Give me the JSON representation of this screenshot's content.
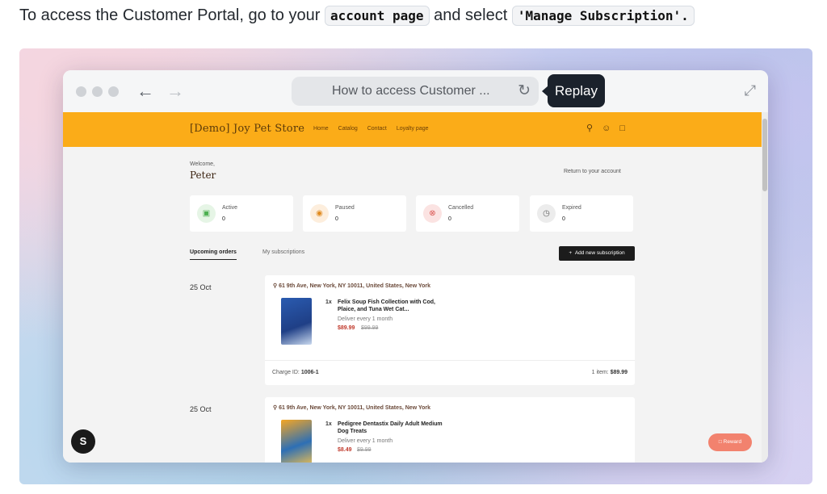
{
  "intro": {
    "text_before": "To access the Customer Portal, go to your ",
    "code1": "account page",
    "text_middle": " and select ",
    "code2": "'Manage Subscription'."
  },
  "browser": {
    "back_icon": "arrow-left-icon",
    "forward_icon": "arrow-right-icon",
    "url_text": "How to access Customer ...",
    "reload_icon": "reload-icon",
    "replay_label": "Replay",
    "expand_icon": "expand-icon"
  },
  "store": {
    "brand": "[Demo] Joy Pet Store",
    "nav": [
      "Home",
      "Catalog",
      "Contact",
      "Loyalty page"
    ],
    "header_icons": [
      "search-icon",
      "account-icon",
      "cart-icon"
    ],
    "accent": "#fbac18"
  },
  "account": {
    "welcome_label": "Welcome,",
    "name": "Peter",
    "return_link": "Return to your account"
  },
  "stats": [
    {
      "label": "Active",
      "count": "0",
      "icon": "box-icon",
      "color": "#4caf50",
      "bg": "#e6f5e6"
    },
    {
      "label": "Paused",
      "count": "0",
      "icon": "pause-icon",
      "color": "#e08a1e",
      "bg": "#fdeedd"
    },
    {
      "label": "Cancelled",
      "count": "0",
      "icon": "cancel-icon",
      "color": "#d9534f",
      "bg": "#fbe3e2"
    },
    {
      "label": "Expired",
      "count": "0",
      "icon": "clock-icon",
      "color": "#666666",
      "bg": "#ececec"
    }
  ],
  "tabs": {
    "upcoming": "Upcoming orders",
    "subscriptions": "My subscriptions",
    "add_button": "Add new subscription"
  },
  "orders": [
    {
      "date": "25 Oct",
      "address": "61 9th Ave, New York, NY 10011, United States, New York",
      "qty": "1x",
      "product": "Felix Soup Fish Collection with Cod, Plaice, and Tuna Wet Cat...",
      "deliver": "Deliver every 1 month",
      "price": "$89.99",
      "old_price": "$99.99",
      "charge_label": "Charge ID:",
      "charge_id": "1006-1",
      "total_label": "1 item:",
      "total": "$89.99"
    },
    {
      "date": "25 Oct",
      "address": "61 9th Ave, New York, NY 10011, United States, New York",
      "qty": "1x",
      "product": "Pedigree Dentastix Daily Adult Medium Dog Treats",
      "deliver": "Deliver every 1 month",
      "price": "$8.49",
      "old_price": "$9.99"
    }
  ],
  "widgets": {
    "shopify_letter": "S",
    "reward_label": "Reward"
  }
}
